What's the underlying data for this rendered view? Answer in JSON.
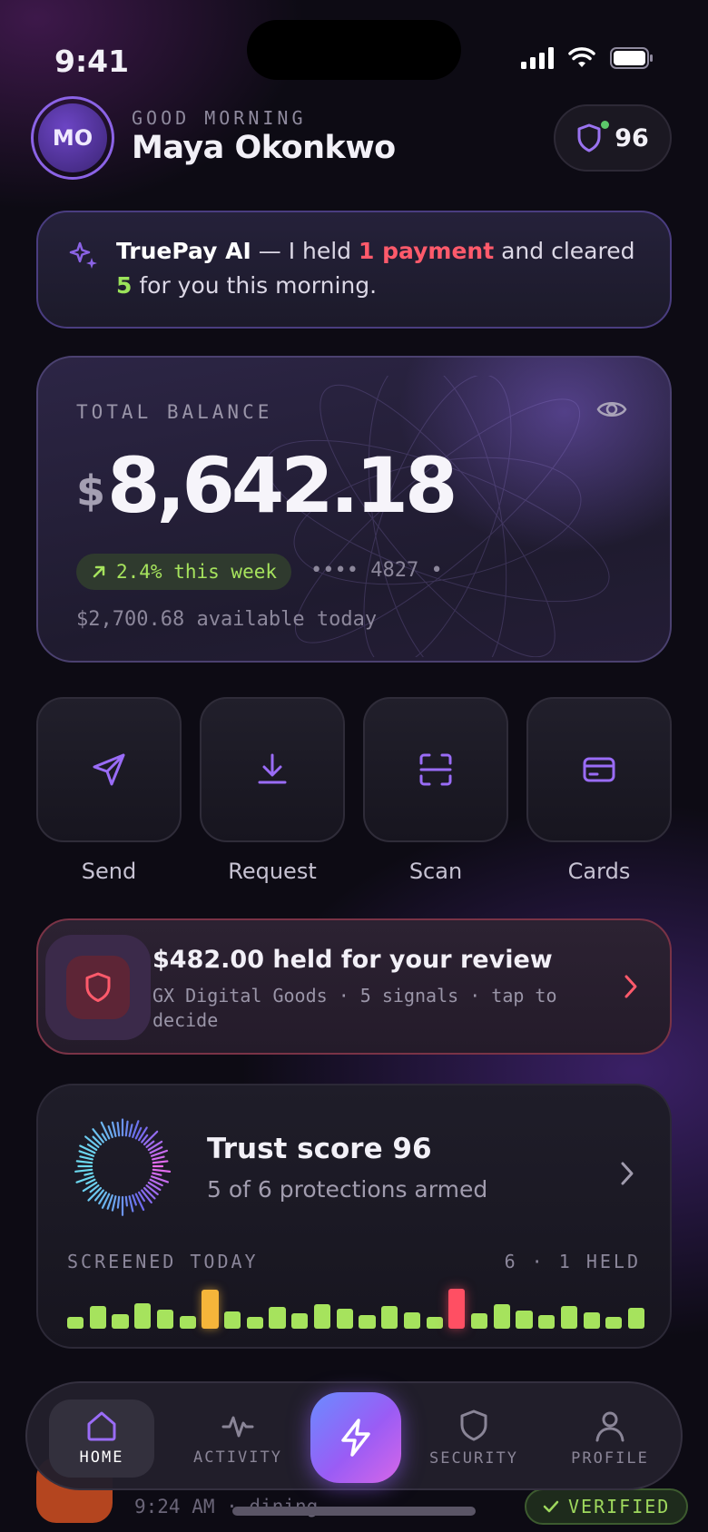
{
  "status_bar": {
    "time": "9:41"
  },
  "header": {
    "avatar_initials": "MO",
    "greeting": "GOOD MORNING",
    "user_name": "Maya Okonkwo",
    "trust_badge_value": "96"
  },
  "ai_banner": {
    "icon": "sparkle-icon",
    "brand": "TruePay AI",
    "text_1": " — I held ",
    "held_count_text": "1 payment",
    "text_2": " and cleared ",
    "cleared_count": "5",
    "text_3": " for you this morning."
  },
  "balance": {
    "label": "TOTAL BALANCE",
    "currency": "$",
    "amount": "8,642.18",
    "change": "2.4% this week",
    "card_mask": "•••• 4827 •",
    "available": "$2,700.68 available today"
  },
  "quick_actions": [
    {
      "label": "Send",
      "icon": "send-icon"
    },
    {
      "label": "Request",
      "icon": "download-icon"
    },
    {
      "label": "Scan",
      "icon": "scan-icon"
    },
    {
      "label": "Cards",
      "icon": "card-icon"
    }
  ],
  "held_payment": {
    "title": "$482.00 held for your review",
    "subtitle": "GX Digital Goods · 5 signals · tap to decide"
  },
  "trust": {
    "title": "Trust score 96",
    "subtitle": "5 of 6 protections armed",
    "screened_label": "SCREENED TODAY",
    "screened_summary": "6 · 1 HELD",
    "bars": [
      {
        "level": 0.28,
        "status": "ok"
      },
      {
        "level": 0.52,
        "status": "ok"
      },
      {
        "level": 0.34,
        "status": "ok"
      },
      {
        "level": 0.58,
        "status": "ok"
      },
      {
        "level": 0.44,
        "status": "ok"
      },
      {
        "level": 0.3,
        "status": "ok"
      },
      {
        "level": 0.9,
        "status": "warn"
      },
      {
        "level": 0.4,
        "status": "ok"
      },
      {
        "level": 0.28,
        "status": "ok"
      },
      {
        "level": 0.5,
        "status": "ok"
      },
      {
        "level": 0.36,
        "status": "ok"
      },
      {
        "level": 0.56,
        "status": "ok"
      },
      {
        "level": 0.46,
        "status": "ok"
      },
      {
        "level": 0.32,
        "status": "ok"
      },
      {
        "level": 0.52,
        "status": "ok"
      },
      {
        "level": 0.38,
        "status": "ok"
      },
      {
        "level": 0.28,
        "status": "ok"
      },
      {
        "level": 0.92,
        "status": "bad"
      },
      {
        "level": 0.36,
        "status": "ok"
      },
      {
        "level": 0.56,
        "status": "ok"
      },
      {
        "level": 0.42,
        "status": "ok"
      },
      {
        "level": 0.32,
        "status": "ok"
      },
      {
        "level": 0.52,
        "status": "ok"
      },
      {
        "level": 0.38,
        "status": "ok"
      },
      {
        "level": 0.28,
        "status": "ok"
      },
      {
        "level": 0.48,
        "status": "ok"
      }
    ]
  },
  "peek_row": {
    "meta": "9:24 AM · dining",
    "badge": "VERIFIED"
  },
  "tab_bar": {
    "tabs": [
      {
        "label": "HOME",
        "icon": "home-icon",
        "active": true
      },
      {
        "label": "ACTIVITY",
        "icon": "activity-icon",
        "active": false
      },
      {
        "label": "SECURITY",
        "icon": "shield-icon",
        "active": false
      },
      {
        "label": "PROFILE",
        "icon": "profile-icon",
        "active": false
      }
    ],
    "center_icon": "bolt-icon"
  },
  "colors": {
    "accent": "#8b63e6",
    "positive": "#a6e35d",
    "danger": "#ff5a6b",
    "warning": "#f5b53a"
  }
}
